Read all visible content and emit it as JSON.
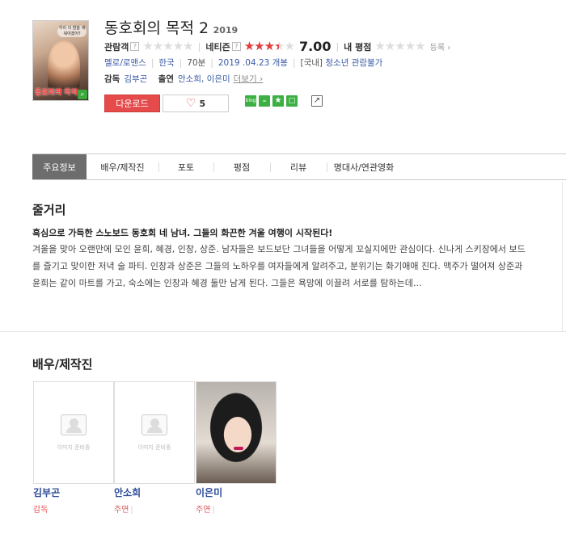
{
  "movie": {
    "title": "동호회의 목적 2",
    "year": "2019",
    "poster": {
      "top_text": "우리 이 밤을 새워야겠어?",
      "title_text": "동호회의 목적"
    }
  },
  "ratings": {
    "audience_label": "관람객",
    "audience_fraction": 0.0,
    "netizen_label": "네티즌",
    "netizen_fraction": 0.7,
    "netizen_score": "7.00",
    "my_label": "내 평점",
    "my_fraction": 0.0,
    "register_label": "등록 ›",
    "help_mark": "?"
  },
  "meta": {
    "genre": "멜로/로맨스",
    "country": "한국",
    "runtime": "70분",
    "release": "2019 .04.23 개봉",
    "grade_prefix": "[국내]",
    "grade": "청소년 관람불가"
  },
  "credits": {
    "director_label": "감독",
    "director": "김부곤",
    "cast_label": "출연",
    "cast": "안소희, 이은미",
    "more": "더보기 ›"
  },
  "actions": {
    "download": "다운로드",
    "like_count": "5",
    "share_icons": [
      "blog-icon",
      "cafe-icon",
      "bookmark-icon",
      "me2day-icon"
    ],
    "blog_text": "blog"
  },
  "tabs": [
    "주요정보",
    "배우/제작진",
    "포토",
    "평점",
    "리뷰",
    "명대사/연관영화"
  ],
  "plot": {
    "heading": "줄거리",
    "headline": "흑심으로 가득한 스노보드 동호회 네 남녀. 그들의 화끈한 겨울 여행이 시작된다!",
    "body": "겨울을 맞아 오랜만에 모인 윤희, 혜경, 인창, 상준. 남자들은 보드보단 그녀들을 어떻게 꼬실지에만 관심이다. 신나게 스키장에서 보드를 즐기고 맞이한 저녁 술 파티. 인창과 상준은 그들의 노하우를 여자들에게 알려주고, 분위기는 화기애애 진다. 맥주가 떨어져 상준과 윤희는 같이 마트를 가고, 숙소에는 인창과 혜경 둘만 남게 된다. 그들은 욕망에 이끌려 서로를 탐하는데…"
  },
  "crew": {
    "heading": "배우/제작진",
    "no_image_text": "이미지 준비중",
    "people": [
      {
        "name": "김부곤",
        "role": "감독",
        "has_photo": false
      },
      {
        "name": "안소희",
        "role": "주연",
        "has_photo": false
      },
      {
        "name": "이은미",
        "role": "주연",
        "has_photo": true
      }
    ]
  }
}
